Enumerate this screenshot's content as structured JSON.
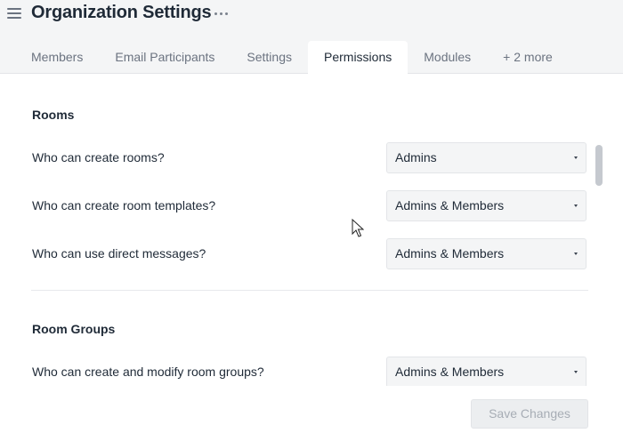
{
  "header": {
    "title": "Organization Settings",
    "tabs": [
      {
        "label": "Members"
      },
      {
        "label": "Email Participants"
      },
      {
        "label": "Settings"
      },
      {
        "label": "Permissions"
      },
      {
        "label": "Modules"
      },
      {
        "label": "+ 2 more"
      }
    ],
    "active_tab": "Permissions"
  },
  "sections": {
    "rooms": {
      "title": "Rooms",
      "rows": [
        {
          "question": "Who can create rooms?",
          "value": "Admins"
        },
        {
          "question": "Who can create room templates?",
          "value": "Admins & Members"
        },
        {
          "question": "Who can use direct messages?",
          "value": "Admins & Members"
        }
      ]
    },
    "room_groups": {
      "title": "Room Groups",
      "rows": [
        {
          "question": "Who can create and modify room groups?",
          "value": "Admins & Members"
        }
      ]
    }
  },
  "footer": {
    "save_label": "Save Changes"
  },
  "icons": {
    "menu": "hamburger-menu-icon",
    "more": "more-horizontal-icon",
    "caret": "caret-down-icon"
  }
}
